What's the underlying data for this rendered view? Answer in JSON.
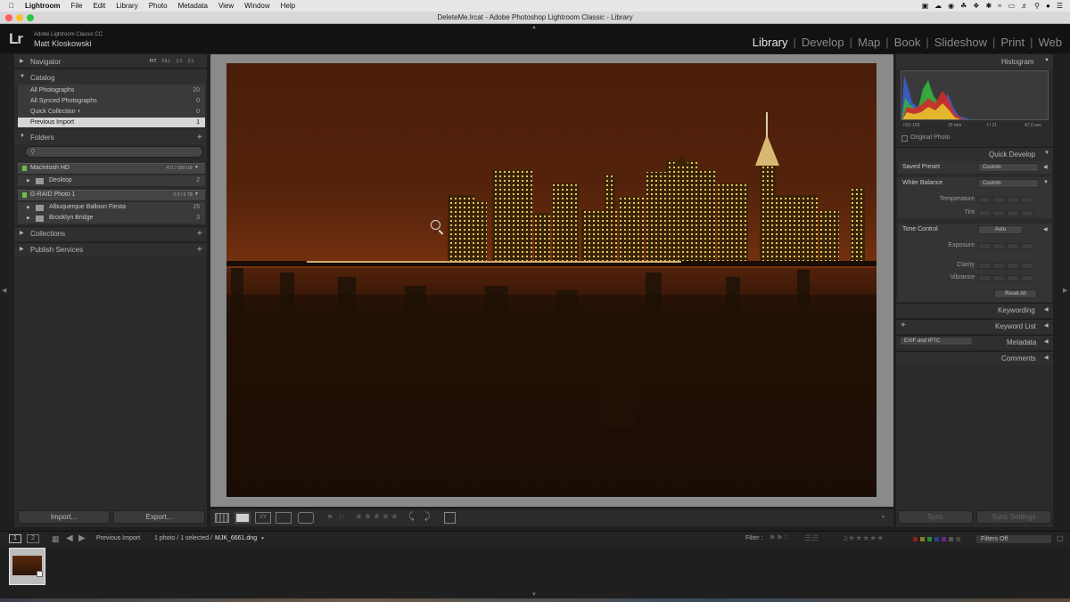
{
  "menubar": {
    "app": "Lightroom",
    "items": [
      "File",
      "Edit",
      "Library",
      "Photo",
      "Metadata",
      "View",
      "Window",
      "Help"
    ]
  },
  "window": {
    "title": "DeleteMe.lrcat - Adobe Photoshop Lightroom Classic - Library"
  },
  "identity": {
    "logo": "Lr",
    "app_name": "Adobe Lightroom Classic CC",
    "user": "Matt Kloskowski"
  },
  "modules": [
    "Library",
    "Develop",
    "Map",
    "Book",
    "Slideshow",
    "Print",
    "Web"
  ],
  "left": {
    "navigator": {
      "label": "Navigator",
      "zoom": [
        "FIT",
        "FILL",
        "1:1",
        "2:1"
      ]
    },
    "catalog": {
      "label": "Catalog",
      "rows": [
        {
          "label": "All Photographs",
          "count": "20"
        },
        {
          "label": "All Synced Photographs",
          "count": "0"
        },
        {
          "label": "Quick Collection +",
          "count": "0"
        },
        {
          "label": "Previous Import",
          "count": "1"
        }
      ]
    },
    "folders": {
      "label": "Folders",
      "volumes": [
        {
          "name": "Macintosh HD",
          "space": "471 / 999 GB",
          "folders": [
            {
              "name": "Desktop",
              "count": "2"
            }
          ]
        },
        {
          "name": "G-RAID Photo 1",
          "space": "0.9 / 6 TB",
          "folders": [
            {
              "name": "Albuquerque Balloon Fiesta",
              "count": "15"
            },
            {
              "name": "Brooklyn Bridge",
              "count": "3"
            }
          ]
        }
      ]
    },
    "collections": "Collections",
    "publish": "Publish Services",
    "import_btn": "Import...",
    "export_btn": "Export..."
  },
  "right": {
    "histogram": {
      "label": "Histogram",
      "iso": "ISO 100",
      "focal": "25 mm",
      "aperture": "f / 11",
      "shutter": "47.0 sec",
      "original": "Original Photo"
    },
    "quick_develop": {
      "label": "Quick Develop",
      "saved_preset": {
        "label": "Saved Preset",
        "value": "Custom"
      },
      "white_balance": {
        "label": "White Balance",
        "value": "Custom"
      },
      "temperature": "Temperature",
      "tint": "Tint",
      "tone_control": {
        "label": "Tone Control",
        "auto": "Auto"
      },
      "exposure": "Exposure",
      "clarity": "Clarity",
      "vibrance": "Vibrance",
      "reset": "Reset All"
    },
    "keywording": "Keywording",
    "keyword_list": "Keyword List",
    "metadata": {
      "label": "Metadata",
      "preset": "EXIF and IPTC"
    },
    "comments": "Comments",
    "sync_btn": "Sync",
    "sync_settings_btn": "Sync Settings"
  },
  "filmstrip": {
    "pages": [
      "1",
      "2"
    ],
    "source": "Previous Import",
    "info": "1 photo / 1 selected /",
    "filename": "MJK_6661.dng",
    "filter_label": "Filter :",
    "filter_value": "Filters Off"
  },
  "colors": {
    "accent": "#e8e8e8",
    "sky": "#4a1e0a",
    "panel": "#2b2b2b",
    "selected_row": "#d6d6d6"
  }
}
